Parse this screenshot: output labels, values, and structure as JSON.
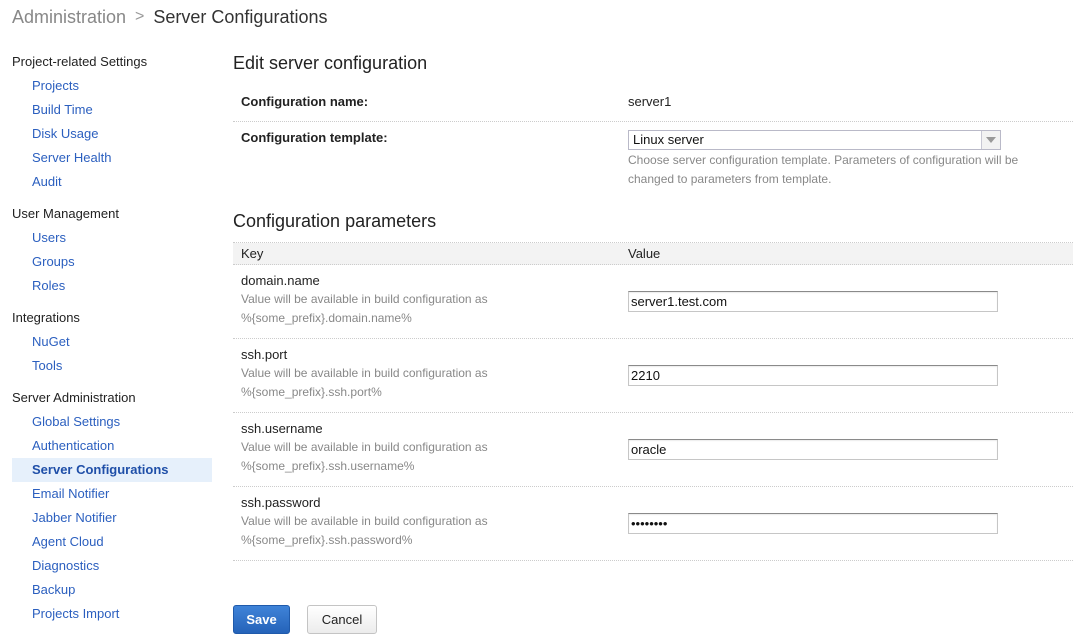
{
  "breadcrumb": {
    "parent": "Administration",
    "separator": ">",
    "current": "Server Configurations"
  },
  "sidebar": {
    "groups": [
      {
        "title": "Project-related Settings",
        "items": [
          "Projects",
          "Build Time",
          "Disk Usage",
          "Server Health",
          "Audit"
        ]
      },
      {
        "title": "User Management",
        "items": [
          "Users",
          "Groups",
          "Roles"
        ]
      },
      {
        "title": "Integrations",
        "items": [
          "NuGet",
          "Tools"
        ]
      },
      {
        "title": "Server Administration",
        "items": [
          "Global Settings",
          "Authentication",
          "Server Configurations",
          "Email Notifier",
          "Jabber Notifier",
          "Agent Cloud",
          "Diagnostics",
          "Backup",
          "Projects Import"
        ]
      }
    ],
    "active_item": "Server Configurations"
  },
  "edit": {
    "title": "Edit server configuration",
    "name_label": "Configuration name:",
    "name_value": "server1",
    "template_label": "Configuration template:",
    "template_value": "Linux server",
    "template_help": "Choose server configuration template. Parameters of configuration will be changed to parameters from template."
  },
  "params": {
    "title": "Configuration parameters",
    "col_key": "Key",
    "col_value": "Value",
    "rows": [
      {
        "key": "domain.name",
        "desc1": "Value will be available in build configuration as",
        "desc2": "%{some_prefix}.domain.name%",
        "value": "server1.test.com",
        "type": "text"
      },
      {
        "key": "ssh.port",
        "desc1": "Value will be available in build configuration as",
        "desc2": "%{some_prefix}.ssh.port%",
        "value": "2210",
        "type": "text"
      },
      {
        "key": "ssh.username",
        "desc1": "Value will be available in build configuration as",
        "desc2": "%{some_prefix}.ssh.username%",
        "value": "oracle",
        "type": "text"
      },
      {
        "key": "ssh.password",
        "desc1": "Value will be available in build configuration as",
        "desc2": "%{some_prefix}.ssh.password%",
        "value": "xxxxxxxx",
        "type": "password"
      }
    ]
  },
  "buttons": {
    "save": "Save",
    "cancel": "Cancel"
  },
  "colors": {
    "link": "#2b5fbf",
    "active_bg": "#e6f0fb",
    "primary_button": "#2f6fc8"
  }
}
